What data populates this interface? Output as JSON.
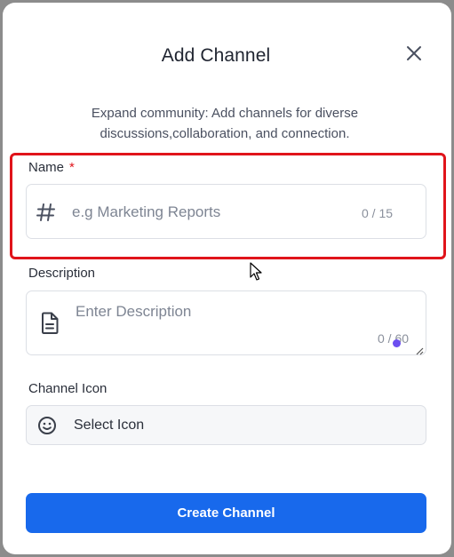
{
  "modal": {
    "title": "Add Channel",
    "subtitle": "Expand community: Add channels for diverse discussions,collaboration, and connection."
  },
  "name_field": {
    "label": "Name",
    "required_marker": "*",
    "icon": "hash-icon",
    "placeholder": "e.g Marketing Reports",
    "counter": "0 / 15"
  },
  "description_field": {
    "label": "Description",
    "icon": "document-icon",
    "placeholder": "Enter Description",
    "counter": "0 / 60"
  },
  "channel_icon_field": {
    "label": "Channel Icon",
    "icon": "smiley-icon",
    "value": "Select Icon"
  },
  "actions": {
    "create_label": "Create Channel"
  },
  "colors": {
    "primary": "#1869ec",
    "highlight": "#e0141b",
    "required": "#e0141b"
  }
}
